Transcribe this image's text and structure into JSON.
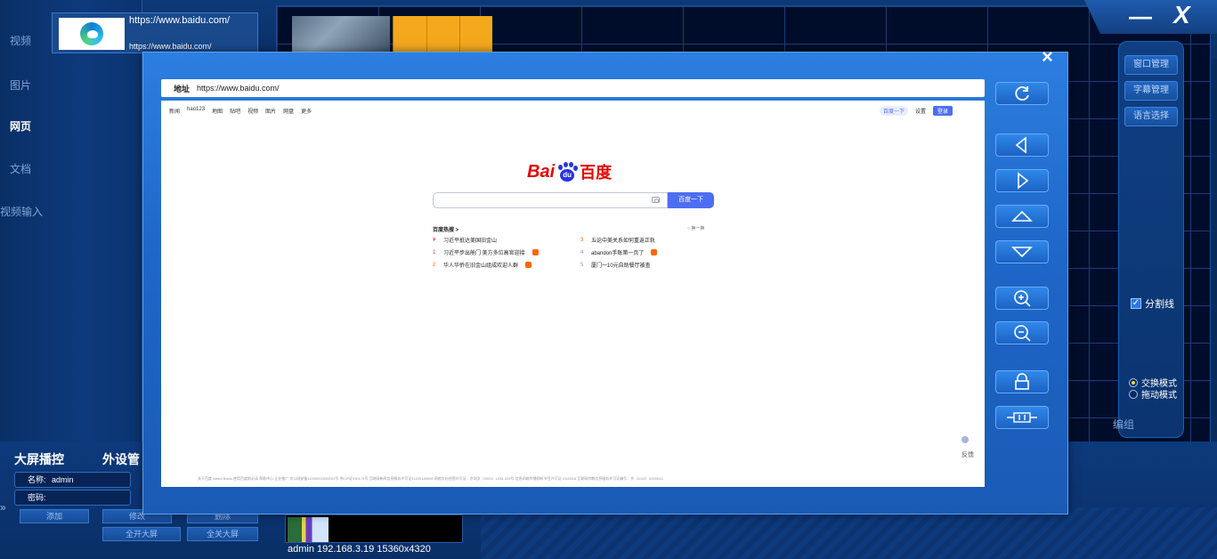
{
  "left_nav": {
    "items": [
      {
        "label": "视频"
      },
      {
        "label": "图片"
      },
      {
        "label": "网页"
      },
      {
        "label": "文档"
      },
      {
        "label": "视频输入"
      }
    ],
    "active_index": 2
  },
  "source_card": {
    "url_line1": "https://www.baidu.com/",
    "url_line2": "https://www.baidu.com/",
    "icon": "edge-icon"
  },
  "window_controls": {
    "minimize_label": "—",
    "close_label": "X"
  },
  "right_panel": {
    "buttons": [
      {
        "label": "窗口管理"
      },
      {
        "label": "字幕管理"
      },
      {
        "label": "语言选择"
      }
    ],
    "divider_checkbox": {
      "label": "分割线",
      "checked": true
    },
    "modes": [
      {
        "label": "交换模式",
        "selected": true
      },
      {
        "label": "拖动模式",
        "selected": false
      }
    ],
    "edit_label": "编组"
  },
  "bottom": {
    "tab_wall": "大屏播控",
    "tab_device": "外设管",
    "name_label": "名称:",
    "name_value": "admin",
    "password_label": "密码:",
    "buttons": [
      "添加",
      "修改",
      "删除",
      "全开大屏",
      "全关大屏"
    ],
    "status": "admin 192.168.3.19 15360x4320"
  },
  "modal": {
    "close_label": "×",
    "address_label": "地址",
    "address_value": "https://www.baidu.com/",
    "controls": [
      "refresh-icon",
      "arrow-left-icon",
      "arrow-right-icon",
      "arrow-up-icon",
      "arrow-down-icon",
      "zoom-in-icon",
      "zoom-out-icon",
      "lock-icon",
      "fit-icon"
    ]
  },
  "baidu": {
    "nav": [
      "新闻",
      "hao123",
      "地图",
      "贴吧",
      "视频",
      "图片",
      "网盘",
      "更多"
    ],
    "top_pill": "百度一下",
    "settings": "设置",
    "login": "登录",
    "logo_bai": "Bai",
    "logo_du": "百度",
    "logo_paw_text": "du",
    "search_button": "百度一下",
    "hot_title": "百度热搜 >",
    "hot_refresh": "换一换",
    "hot_left": [
      {
        "rank": "¥",
        "text": "习近平抵达美国旧金山"
      },
      {
        "rank": "1",
        "text": "习近平步出舱门 美方多位高官迎接"
      },
      {
        "rank": "2",
        "text": "华人华侨在旧金山组成欢迎人群"
      }
    ],
    "hot_right": [
      {
        "rank": "3",
        "text": "五论中美关系如何重返正轨"
      },
      {
        "rank": "4",
        "text": "abandon手账第一页了"
      },
      {
        "rank": "5",
        "text": "厦门一10元自助餐厅被查"
      }
    ],
    "footer": "关于百度   About Baidu   使用百度前必读   帮助中心   企业推广   京公网安备11000002000001号   京ICP证030173号   互联网新闻信息服务许可证11220180008   网络文化经营许可证：京网文〔2023〕1034-029号   信息网络传播视听节目许可证 0110516   互联网宗教信息服务许可证编号：京（2022）0000043",
    "side_float": "反馈"
  }
}
